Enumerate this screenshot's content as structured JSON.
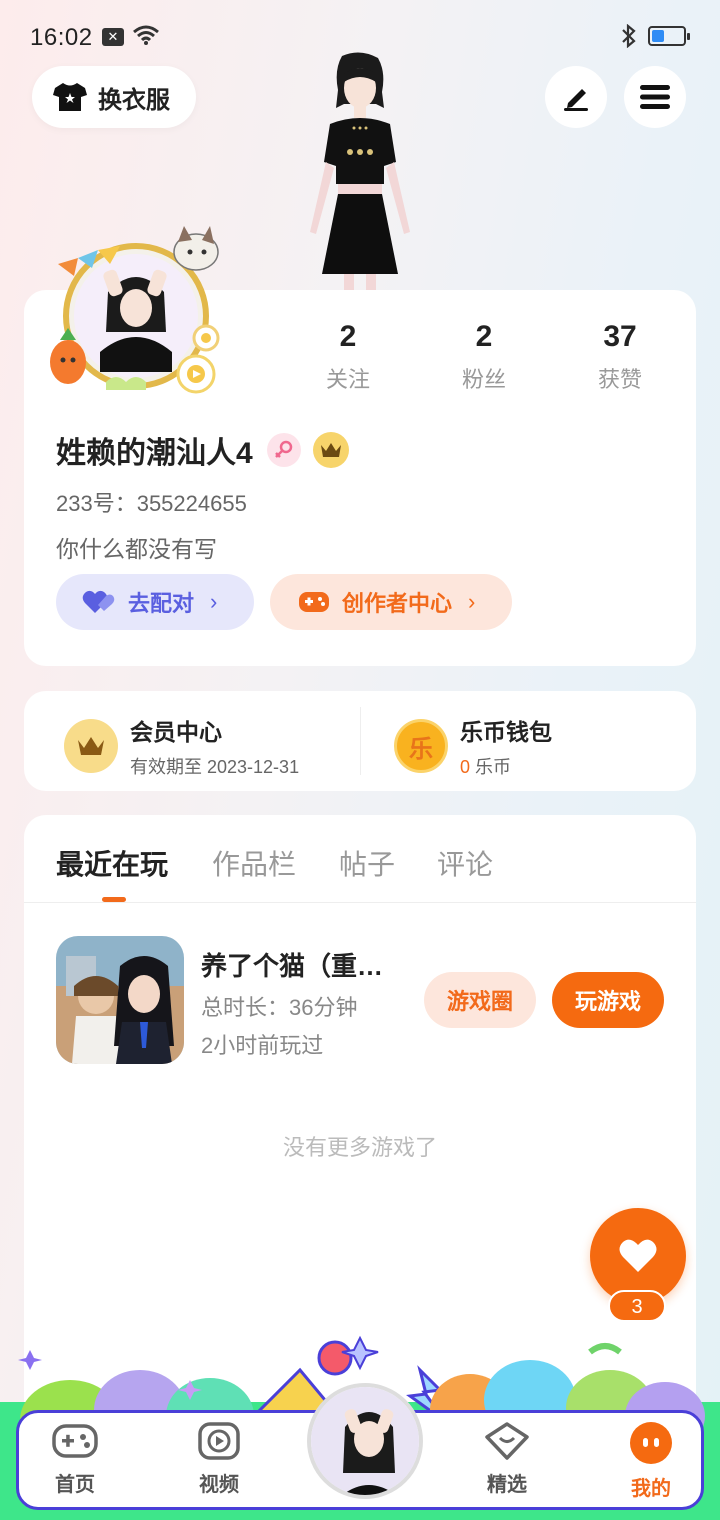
{
  "status_bar": {
    "time": "16:02",
    "battery_percent": 20
  },
  "top": {
    "dress_label": "换衣服"
  },
  "profile": {
    "stats": [
      {
        "value": "2",
        "label": "关注"
      },
      {
        "value": "2",
        "label": "粉丝"
      },
      {
        "value": "37",
        "label": "获赞"
      }
    ],
    "username": "姓赖的潮汕人4",
    "uid": "233号：355224655",
    "bio": "你什么都没有写",
    "match_label": "去配对",
    "creator_label": "创作者中心"
  },
  "member": {
    "vip_title": "会员中心",
    "vip_sub": "有效期至 2023-12-31",
    "wallet_title": "乐币钱包",
    "wallet_amount": "0",
    "wallet_unit": "乐币",
    "wallet_icon_char": "乐"
  },
  "tabs": [
    "最近在玩",
    "作品栏",
    "帖子",
    "评论"
  ],
  "games": [
    {
      "name": "养了个猫（重…",
      "total_time": "总时长：36分钟",
      "last_played": "2小时前玩过",
      "circle_label": "游戏圈",
      "play_label": "玩游戏"
    }
  ],
  "no_more_text": "没有更多游戏了",
  "fab": {
    "badge": "3"
  },
  "nav": [
    {
      "label": "首页",
      "icon": "gamepad-icon"
    },
    {
      "label": "视频",
      "icon": "play-icon"
    },
    {
      "label": "精选",
      "icon": "heart-box-icon"
    },
    {
      "label": "我的",
      "icon": "face-icon"
    }
  ],
  "colors": {
    "accent": "#f56a10",
    "match": "#5a5fe0",
    "nav_border": "#4a3fd8"
  }
}
